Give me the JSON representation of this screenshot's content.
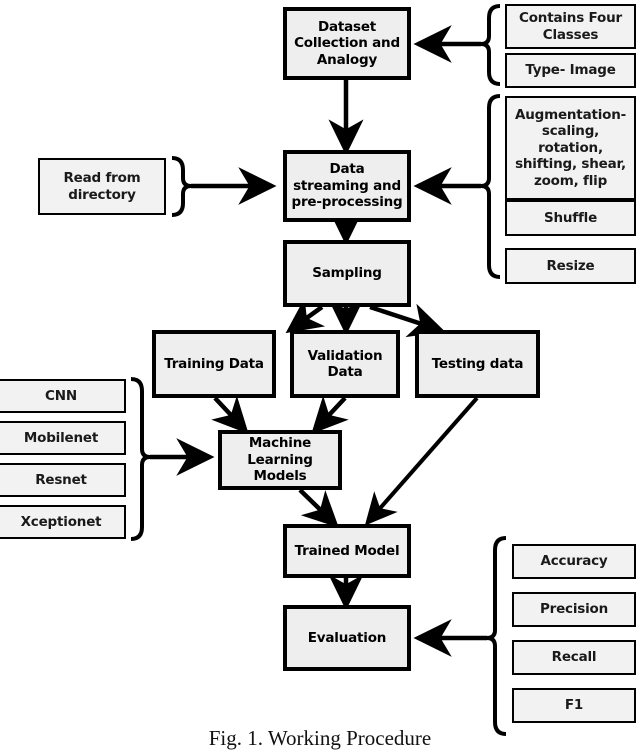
{
  "figure": {
    "caption": "Fig. 1.  Working Procedure",
    "background": "#ffffff",
    "node_fill": "#eeeeee",
    "side_fill": "#f2f2f2",
    "stroke": "#000000"
  },
  "main_flow": {
    "dataset_collection": "Dataset Collection and Analogy",
    "data_streaming": "Data streaming and pre-processing",
    "sampling": "Sampling",
    "training_data": "Training Data",
    "validation_data": "Validation Data",
    "testing_data": "Testing data",
    "ml_models": "Machine Learning Models",
    "trained_model": "Trained Model",
    "evaluation": "Evaluation"
  },
  "dataset_properties": [
    {
      "label": "Contains Four Classes"
    },
    {
      "label": "Type- Image"
    }
  ],
  "preprocessing_steps": [
    {
      "label": "Augmentation- scaling, rotation, shifting, shear, zoom, flip"
    },
    {
      "label": "Shuffle"
    },
    {
      "label": "Resize"
    }
  ],
  "input_source": {
    "read_from_directory": "Read from directory"
  },
  "model_architectures": [
    {
      "label": "CNN"
    },
    {
      "label": "Mobilenet"
    },
    {
      "label": "Resnet"
    },
    {
      "label": "Xceptionet"
    }
  ],
  "evaluation_metrics": [
    {
      "label": "Accuracy"
    },
    {
      "label": "Precision"
    },
    {
      "label": "Recall"
    },
    {
      "label": "F1"
    }
  ]
}
